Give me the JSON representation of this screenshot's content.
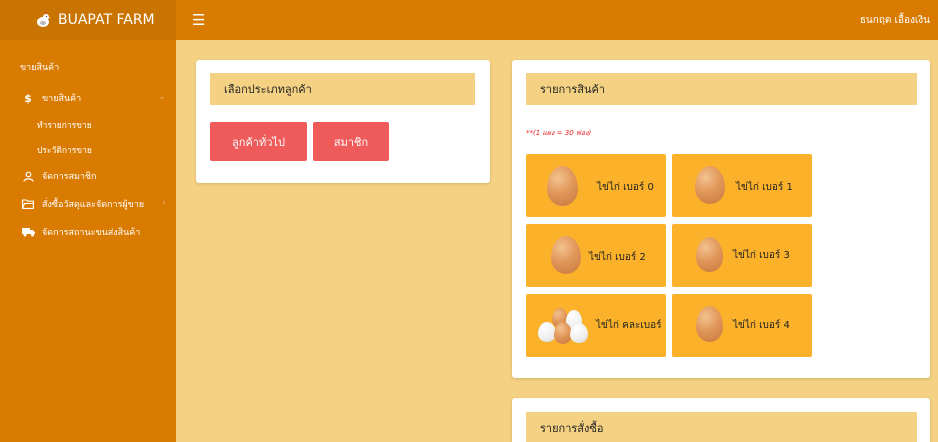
{
  "brand": {
    "name": "BUAPAT FARM"
  },
  "header": {
    "menu_icon": "hamburger-icon",
    "user": "ธนกฤต เอื้องเงิน"
  },
  "sidebar": {
    "header": "ขายสินค้า",
    "items": [
      {
        "label": "ขายสินค้า",
        "icon": "dollar-icon"
      },
      {
        "label": "ทำรายการขาย"
      },
      {
        "label": "ประวัติการขาย"
      },
      {
        "label": "จัดการสมาชิก",
        "icon": "user-icon"
      },
      {
        "label": "สั่งซื้อวัสดุและจัดการผู้ขาย",
        "icon": "folder-icon"
      },
      {
        "label": "จัดการสถานะขนส่งสินค้า",
        "icon": "truck-icon"
      }
    ]
  },
  "customer_card": {
    "title": "เลือกประเภทลูกค้า",
    "buttons": [
      "ลูกค้าทั่วไป",
      "สมาชิก"
    ]
  },
  "products_card": {
    "title": "รายการสินค้า",
    "note": "**(1 แผง = 30 ฟอง)",
    "products": [
      "ไข่ไก่ เบอร์ 0",
      "ไข่ไก่ เบอร์ 1",
      "ไข่ไก่ เบอร์ 2",
      "ไข่ไก่ เบอร์ 3",
      "ไข่ไก่ คละเบอร์",
      "ไข่ไก่ เบอร์ 4"
    ]
  },
  "orders_card": {
    "title": "รายการสั่งซื้อ"
  },
  "colors": {
    "sidebar": "#d97b00",
    "brand": "#c97400",
    "background": "#f5d183",
    "button": "#ef5a5a",
    "tile": "#fbb22a",
    "note": "#e52020"
  }
}
